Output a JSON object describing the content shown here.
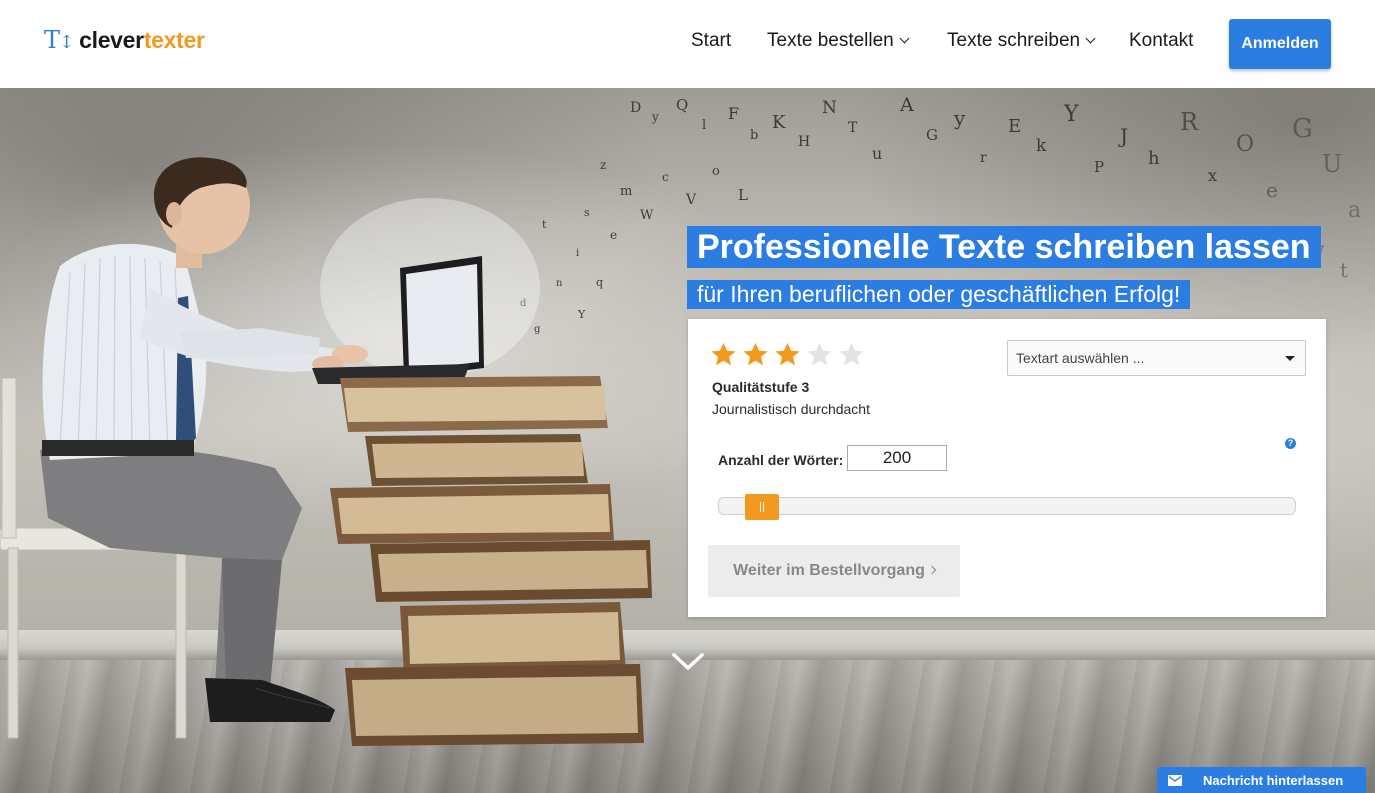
{
  "brand": {
    "logo_mark": "T",
    "name_part1": "clever",
    "name_part2": "texter",
    "color_primary": "#2b7de1",
    "color_accent": "#f29a1f"
  },
  "nav": {
    "items": [
      {
        "label": "Start"
      },
      {
        "label": "Texte bestellen",
        "dropdown": true
      },
      {
        "label": "Texte schreiben",
        "dropdown": true
      },
      {
        "label": "Kontakt"
      }
    ],
    "login_label": "Anmelden"
  },
  "hero": {
    "headline": "Professionelle Texte schreiben lassen",
    "subheadline": "für Ihren beruflichen oder geschäftlichen Erfolg!"
  },
  "order_form": {
    "rating": {
      "value": 3,
      "max": 5
    },
    "quality_title": "Qualitätstufe 3",
    "quality_description": "Journalistisch durchdacht",
    "text_type_select": {
      "value": "Textart auswählen ..."
    },
    "help_icon": "question-icon",
    "words_label": "Anzahl der Wörter:",
    "words_value": "200",
    "slider": {
      "value": 200
    },
    "next_button": "Weiter im Bestellvorgang"
  },
  "scroll_icon": "chevron-down-icon",
  "message_tab": {
    "label": "Nachricht hinterlassen",
    "icon": "mail-icon"
  }
}
